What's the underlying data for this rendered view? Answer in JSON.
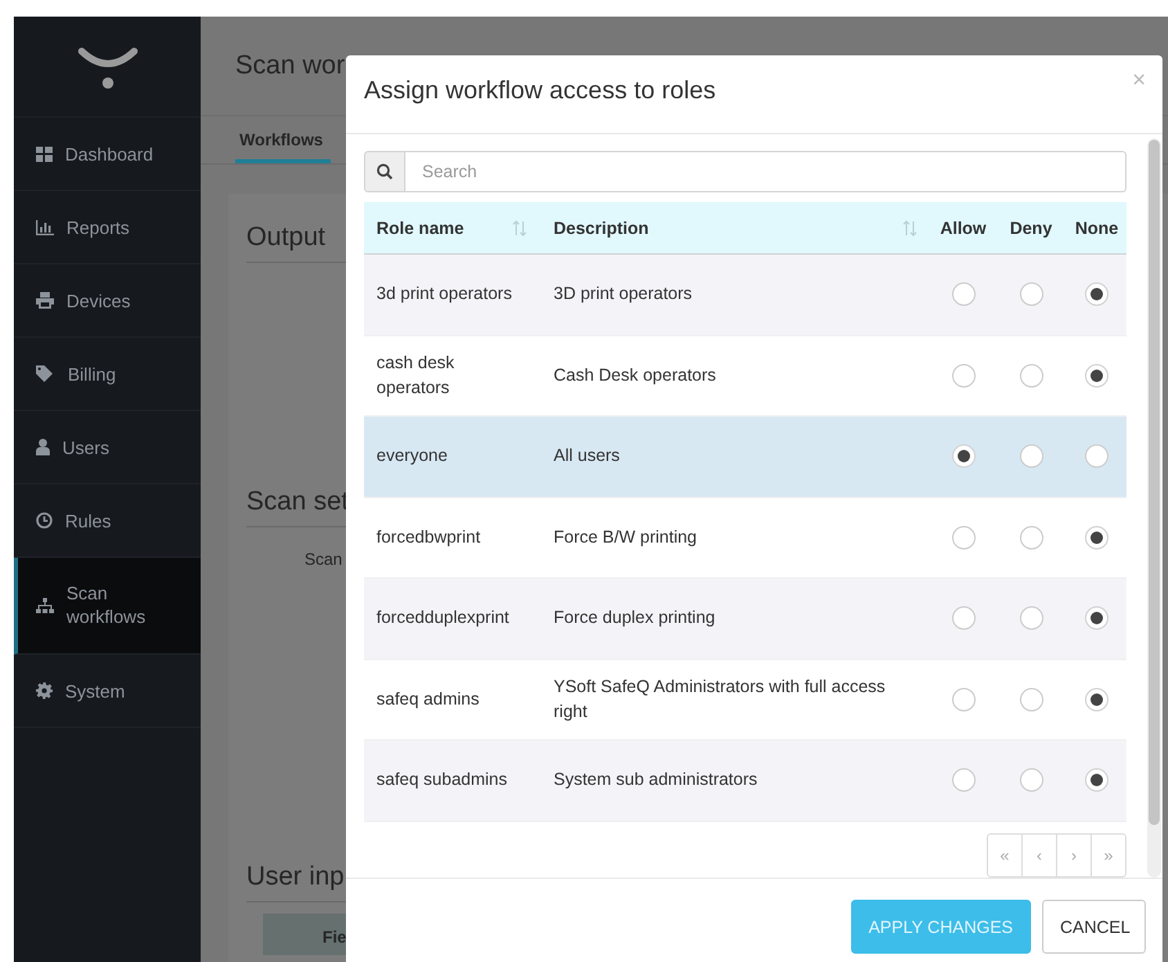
{
  "sidebar": {
    "items": [
      {
        "label": "Dashboard",
        "selected": false
      },
      {
        "label": "Reports",
        "selected": false
      },
      {
        "label": "Devices",
        "selected": false
      },
      {
        "label": "Billing",
        "selected": false
      },
      {
        "label": "Users",
        "selected": false
      },
      {
        "label": "Rules",
        "selected": false
      },
      {
        "label": "Scan workflows",
        "selected": true
      },
      {
        "label": "System",
        "selected": false
      }
    ]
  },
  "page": {
    "title": "Scan wor",
    "tabs": [
      {
        "label": "Workflows",
        "selected": true
      }
    ],
    "sections": [
      {
        "heading": "Output"
      },
      {
        "heading": "Scan set",
        "field_label": "Scan"
      },
      {
        "heading": "User inp",
        "table_header": "Fie"
      }
    ]
  },
  "dialog": {
    "title": "Assign workflow access to roles",
    "close": "×",
    "search": {
      "placeholder": "Search"
    },
    "columns": [
      {
        "label": "Role name",
        "sortable": true
      },
      {
        "label": "Description",
        "sortable": true
      },
      {
        "label": "Allow",
        "sortable": false
      },
      {
        "label": "Deny",
        "sortable": false
      },
      {
        "label": "None",
        "sortable": false
      }
    ],
    "rows": [
      {
        "role": "3d print operators",
        "description": "3D print operators",
        "allow": false,
        "deny": false,
        "none": true,
        "selected": false
      },
      {
        "role": "cash desk operators",
        "description": "Cash Desk operators",
        "allow": false,
        "deny": false,
        "none": true,
        "selected": false
      },
      {
        "role": "everyone",
        "description": "All users",
        "allow": true,
        "deny": false,
        "none": false,
        "selected": true
      },
      {
        "role": "forcedbwprint",
        "description": "Force B/W printing",
        "allow": false,
        "deny": false,
        "none": true,
        "selected": false
      },
      {
        "role": "forcedduplexprint",
        "description": "Force duplex printing",
        "allow": false,
        "deny": false,
        "none": true,
        "selected": false
      },
      {
        "role": "safeq admins",
        "description": "YSoft SafeQ Administrators with full access right",
        "allow": false,
        "deny": false,
        "none": true,
        "selected": false
      },
      {
        "role": "safeq subadmins",
        "description": "System sub administrators",
        "allow": false,
        "deny": false,
        "none": true,
        "selected": false
      }
    ],
    "pagination": [
      "«",
      "‹",
      "›",
      "»"
    ],
    "buttons": [
      {
        "label": "APPLY CHANGES",
        "kind": "primary"
      },
      {
        "label": "CANCEL",
        "kind": "default"
      }
    ]
  }
}
